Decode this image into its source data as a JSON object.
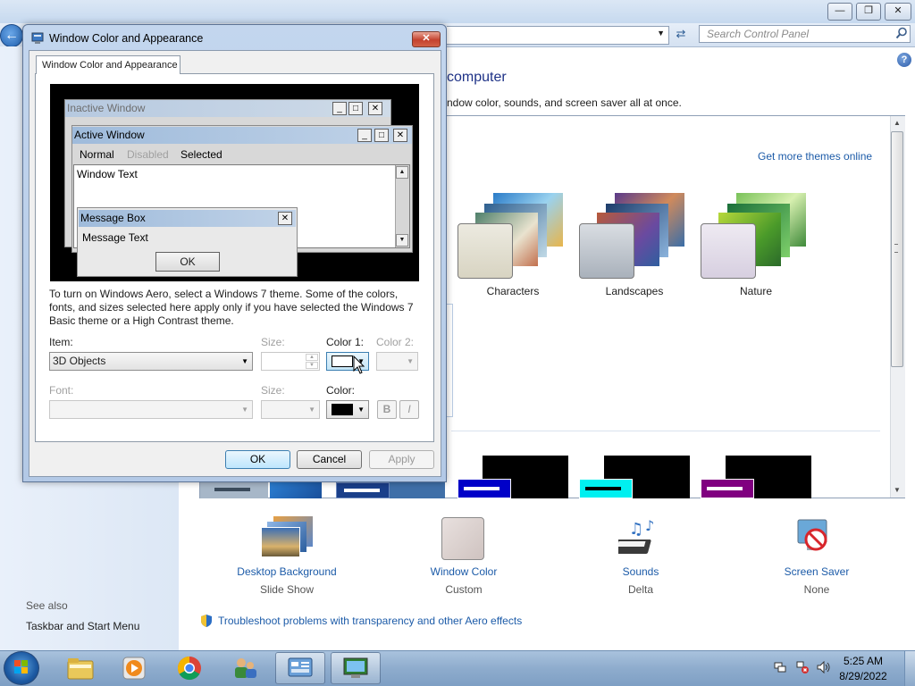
{
  "control_panel": {
    "search_placeholder": "Search Control Panel",
    "heading": "computer",
    "subheading": "ndow color, sounds, and screen saver all at once.",
    "get_more_themes": "Get more themes online",
    "themes": [
      {
        "label": "Characters"
      },
      {
        "label": "Landscapes"
      },
      {
        "label": "Nature"
      }
    ],
    "bottom_items": [
      {
        "link": "Desktop Background",
        "sub": "Slide Show"
      },
      {
        "link": "Window Color",
        "sub": "Custom"
      },
      {
        "link": "Sounds",
        "sub": "Delta"
      },
      {
        "link": "Screen Saver",
        "sub": "None"
      }
    ],
    "see_also": "See also",
    "taskbar_link": "Taskbar and Start Menu",
    "troubleshoot": "Troubleshoot problems with transparency and other Aero effects"
  },
  "dialog": {
    "title": "Window Color and Appearance",
    "tab": "Window Color and Appearance",
    "preview": {
      "inactive_title": "Inactive Window",
      "active_title": "Active Window",
      "menu_normal": "Normal",
      "menu_disabled": "Disabled",
      "menu_selected": "Selected",
      "window_text": "Window Text",
      "msgbox_title": "Message Box",
      "msgbox_text": "Message Text",
      "msgbox_ok": "OK"
    },
    "description": "To turn on Windows Aero, select a Windows 7 theme.  Some of the colors, fonts, and sizes selected here apply only if you have selected the Windows 7 Basic theme or a High Contrast theme.",
    "item_label": "Item:",
    "item_value": "3D Objects",
    "size_label": "Size:",
    "color1_label": "Color 1:",
    "color2_label": "Color 2:",
    "font_label": "Font:",
    "size2_label": "Size:",
    "color_label": "Color:",
    "bold_label": "B",
    "italic_label": "I",
    "ok": "OK",
    "cancel": "Cancel",
    "apply": "Apply",
    "color1_swatch": "#ffffff",
    "color_swatch": "#000000"
  },
  "taskbar": {
    "time": "5:25 AM",
    "date": "8/29/2022"
  }
}
